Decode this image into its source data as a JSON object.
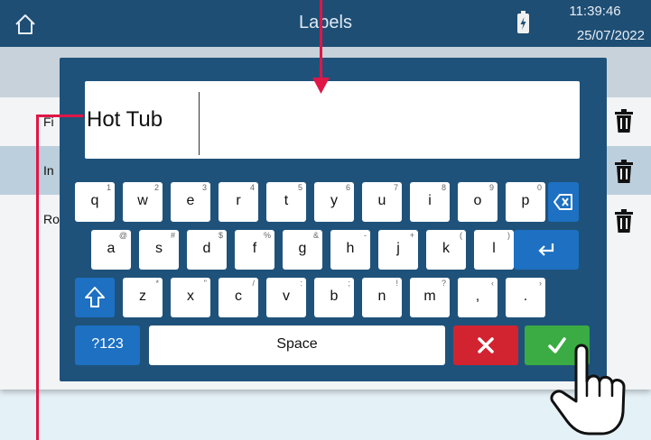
{
  "header": {
    "title": "Labels",
    "time": "11:39:46",
    "date": "25/07/2022"
  },
  "list": {
    "rows": [
      {
        "label": "Fi"
      },
      {
        "label": "In"
      },
      {
        "label": "Ro"
      }
    ]
  },
  "keyboard": {
    "input_value": "Hot Tub",
    "row1": [
      {
        "key": "q",
        "sub": "1"
      },
      {
        "key": "w",
        "sub": "2"
      },
      {
        "key": "e",
        "sub": "3"
      },
      {
        "key": "r",
        "sub": "4"
      },
      {
        "key": "t",
        "sub": "5"
      },
      {
        "key": "y",
        "sub": "6"
      },
      {
        "key": "u",
        "sub": "7"
      },
      {
        "key": "i",
        "sub": "8"
      },
      {
        "key": "o",
        "sub": "9"
      },
      {
        "key": "p",
        "sub": "0"
      }
    ],
    "row2": [
      {
        "key": "a",
        "sub": "@"
      },
      {
        "key": "s",
        "sub": "#"
      },
      {
        "key": "d",
        "sub": "$"
      },
      {
        "key": "f",
        "sub": "%"
      },
      {
        "key": "g",
        "sub": "&"
      },
      {
        "key": "h",
        "sub": "-"
      },
      {
        "key": "j",
        "sub": "+"
      },
      {
        "key": "k",
        "sub": "("
      },
      {
        "key": "l",
        "sub": ")"
      }
    ],
    "row3": [
      {
        "key": "z",
        "sub": "*"
      },
      {
        "key": "x",
        "sub": "\""
      },
      {
        "key": "c",
        "sub": "/"
      },
      {
        "key": "v",
        "sub": ":"
      },
      {
        "key": "b",
        "sub": ";"
      },
      {
        "key": "n",
        "sub": "!"
      },
      {
        "key": "m",
        "sub": "?"
      },
      {
        "key": ",",
        "sub": "‹"
      },
      {
        "key": ".",
        "sub": "›"
      }
    ],
    "symbols_label": "?123",
    "space_label": "Space"
  },
  "icons": {
    "home": "home-icon",
    "battery": "battery-icon",
    "trash": "trash-icon",
    "backspace": "backspace-icon",
    "enter": "enter-icon",
    "shift": "shift-icon",
    "cancel": "close-icon",
    "confirm": "checkmark-icon",
    "pointer": "hand-pointer-icon"
  },
  "colors": {
    "header": "#1e4e74",
    "dialog": "#1f527a",
    "accent_blue": "#1d70c2",
    "cancel": "#d22330",
    "confirm": "#3aac43",
    "annotation": "#e01646"
  }
}
